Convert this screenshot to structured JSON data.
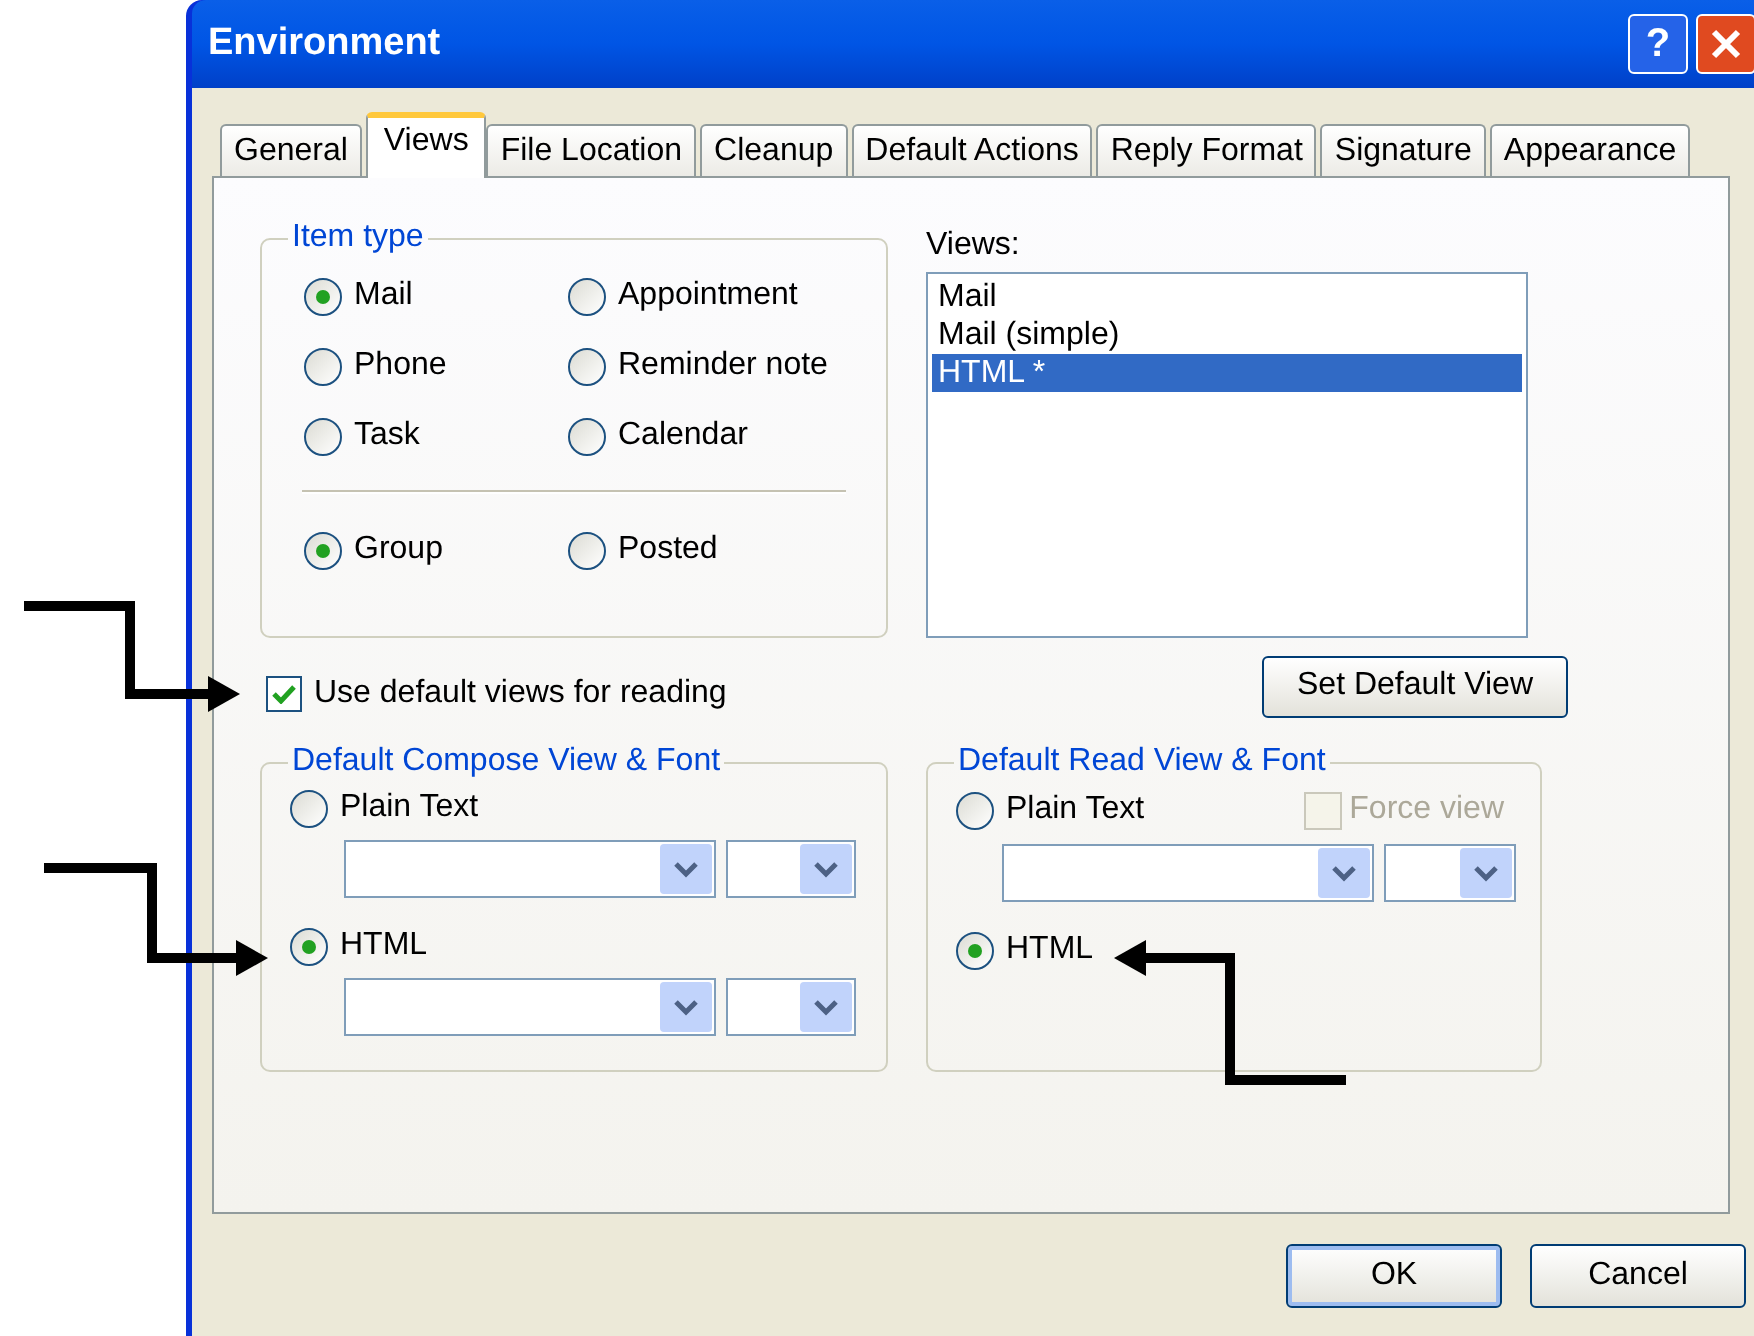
{
  "window": {
    "title": "Environment",
    "help_label": "?"
  },
  "tabs": [
    {
      "label": "General",
      "selected": false
    },
    {
      "label": "Views",
      "selected": true
    },
    {
      "label": "File Location",
      "selected": false
    },
    {
      "label": "Cleanup",
      "selected": false
    },
    {
      "label": "Default Actions",
      "selected": false
    },
    {
      "label": "Reply Format",
      "selected": false
    },
    {
      "label": "Signature",
      "selected": false
    },
    {
      "label": "Appearance",
      "selected": false
    }
  ],
  "item_type": {
    "title": "Item type",
    "options": [
      {
        "label": "Mail",
        "selected": true
      },
      {
        "label": "Appointment",
        "selected": false
      },
      {
        "label": "Phone",
        "selected": false
      },
      {
        "label": "Reminder note",
        "selected": false
      },
      {
        "label": "Task",
        "selected": false
      },
      {
        "label": "Calendar",
        "selected": false
      }
    ],
    "scope_options": [
      {
        "label": "Group",
        "selected": true
      },
      {
        "label": "Posted",
        "selected": false
      }
    ]
  },
  "views": {
    "label": "Views:",
    "items": [
      {
        "label": "Mail",
        "selected": false
      },
      {
        "label": "Mail (simple)",
        "selected": false
      },
      {
        "label": "HTML *",
        "selected": true
      }
    ]
  },
  "use_default_views": {
    "label": "Use default views for reading",
    "checked": true
  },
  "set_default_view": "Set Default View",
  "compose": {
    "title": "Default Compose View & Font",
    "options": [
      {
        "label": "Plain Text",
        "selected": false
      },
      {
        "label": "HTML",
        "selected": true
      }
    ]
  },
  "read": {
    "title": "Default Read View & Font",
    "options": [
      {
        "label": "Plain Text",
        "selected": false
      },
      {
        "label": "HTML",
        "selected": true
      }
    ],
    "force_view": {
      "label": "Force view",
      "checked": false,
      "disabled": true
    }
  },
  "buttons": [
    {
      "label": "OK",
      "kind": "default"
    },
    {
      "label": "Cancel",
      "kind": "normal"
    }
  ]
}
